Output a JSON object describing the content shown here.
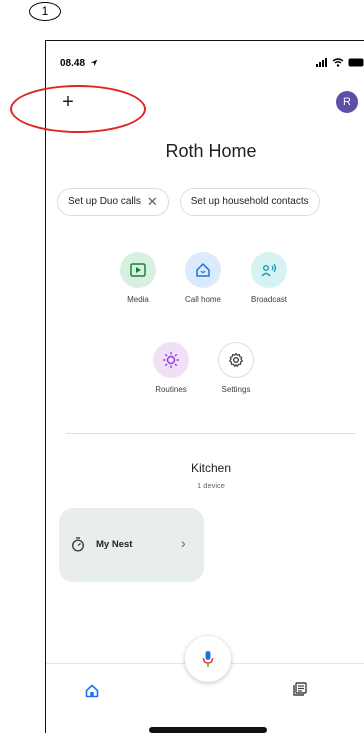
{
  "step_marker": "1",
  "status_bar": {
    "time": "08.48"
  },
  "header": {
    "add_symbol": "+",
    "avatar_initial": "R"
  },
  "home": {
    "title": "Roth Home"
  },
  "chips": [
    {
      "label": "Set up Duo calls",
      "close_symbol": "✕"
    },
    {
      "label": "Set up household contacts"
    }
  ],
  "actions": [
    {
      "label": "Media",
      "icon": "media-icon",
      "color": "#d7f0df"
    },
    {
      "label": "Call home",
      "icon": "call-home-icon",
      "color": "#dbeafc"
    },
    {
      "label": "Broadcast",
      "icon": "broadcast-icon",
      "color": "#d5f3f3"
    },
    {
      "label": "Routines",
      "icon": "routines-icon",
      "color": "#efe0f5"
    },
    {
      "label": "Settings",
      "icon": "gear-icon",
      "color": "#ffffff"
    }
  ],
  "room": {
    "name": "Kitchen",
    "device_count": "1 device"
  },
  "device": {
    "name": "My Nest",
    "chevron": "›"
  },
  "colors": {
    "annotation": "#e02323",
    "avatar": "#5b50a5",
    "card": "#e8eded",
    "accent_blue": "#1a73e8"
  }
}
